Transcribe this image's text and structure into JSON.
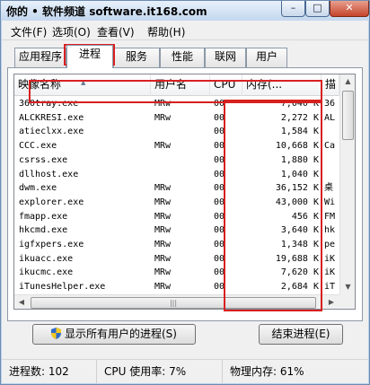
{
  "window": {
    "title": "你的 • 软件频道 software.it168.com"
  },
  "controls": {
    "minimize": "–",
    "maximize": "□",
    "close": "✕"
  },
  "menu": [
    "文件(F)",
    "选项(O)",
    "查看(V)",
    "帮助(H)"
  ],
  "tabs": [
    "应用程序",
    "进程",
    "服务",
    "性能",
    "联网",
    "用户"
  ],
  "active_tab": "进程",
  "columns": {
    "name": "映像名称",
    "user": "用户名",
    "cpu": "CPU",
    "mem": "内存(...",
    "desc": "描"
  },
  "rows": [
    {
      "name": "360tray.exe",
      "user": "MRw",
      "cpu": "00",
      "mem": "7,040 K",
      "desc": "36"
    },
    {
      "name": "ALCKRESI.exe",
      "user": "MRw",
      "cpu": "00",
      "mem": "2,272 K",
      "desc": "AL"
    },
    {
      "name": "atieclxx.exe",
      "user": "",
      "cpu": "00",
      "mem": "1,584 K",
      "desc": ""
    },
    {
      "name": "CCC.exe",
      "user": "MRw",
      "cpu": "00",
      "mem": "10,668 K",
      "desc": "Ca"
    },
    {
      "name": "csrss.exe",
      "user": "",
      "cpu": "00",
      "mem": "1,880 K",
      "desc": ""
    },
    {
      "name": "dllhost.exe",
      "user": "",
      "cpu": "00",
      "mem": "1,040 K",
      "desc": ""
    },
    {
      "name": "dwm.exe",
      "user": "MRw",
      "cpu": "00",
      "mem": "36,152 K",
      "desc": "桌"
    },
    {
      "name": "explorer.exe",
      "user": "MRw",
      "cpu": "00",
      "mem": "43,000 K",
      "desc": "Wi"
    },
    {
      "name": "fmapp.exe",
      "user": "MRw",
      "cpu": "00",
      "mem": "456 K",
      "desc": "FM"
    },
    {
      "name": "hkcmd.exe",
      "user": "MRw",
      "cpu": "00",
      "mem": "3,640 K",
      "desc": "hk"
    },
    {
      "name": "igfxpers.exe",
      "user": "MRw",
      "cpu": "00",
      "mem": "1,348 K",
      "desc": "pe"
    },
    {
      "name": "ikuacc.exe",
      "user": "MRw",
      "cpu": "00",
      "mem": "19,688 K",
      "desc": "iK"
    },
    {
      "name": "ikucmc.exe",
      "user": "MRw",
      "cpu": "00",
      "mem": "7,620 K",
      "desc": "iK"
    },
    {
      "name": "iTunesHelper.exe",
      "user": "MRw",
      "cpu": "00",
      "mem": "2,684 K",
      "desc": "iT"
    }
  ],
  "buttons": {
    "show_all": "显示所有用户的进程(S)",
    "end_process": "结束进程(E)"
  },
  "status": {
    "processes": "进程数: 102",
    "cpu": "CPU 使用率: 7%",
    "memory": "物理内存: 61%"
  },
  "colors": {
    "highlight": "#d82020",
    "window_frame": "#bcd2ea"
  }
}
